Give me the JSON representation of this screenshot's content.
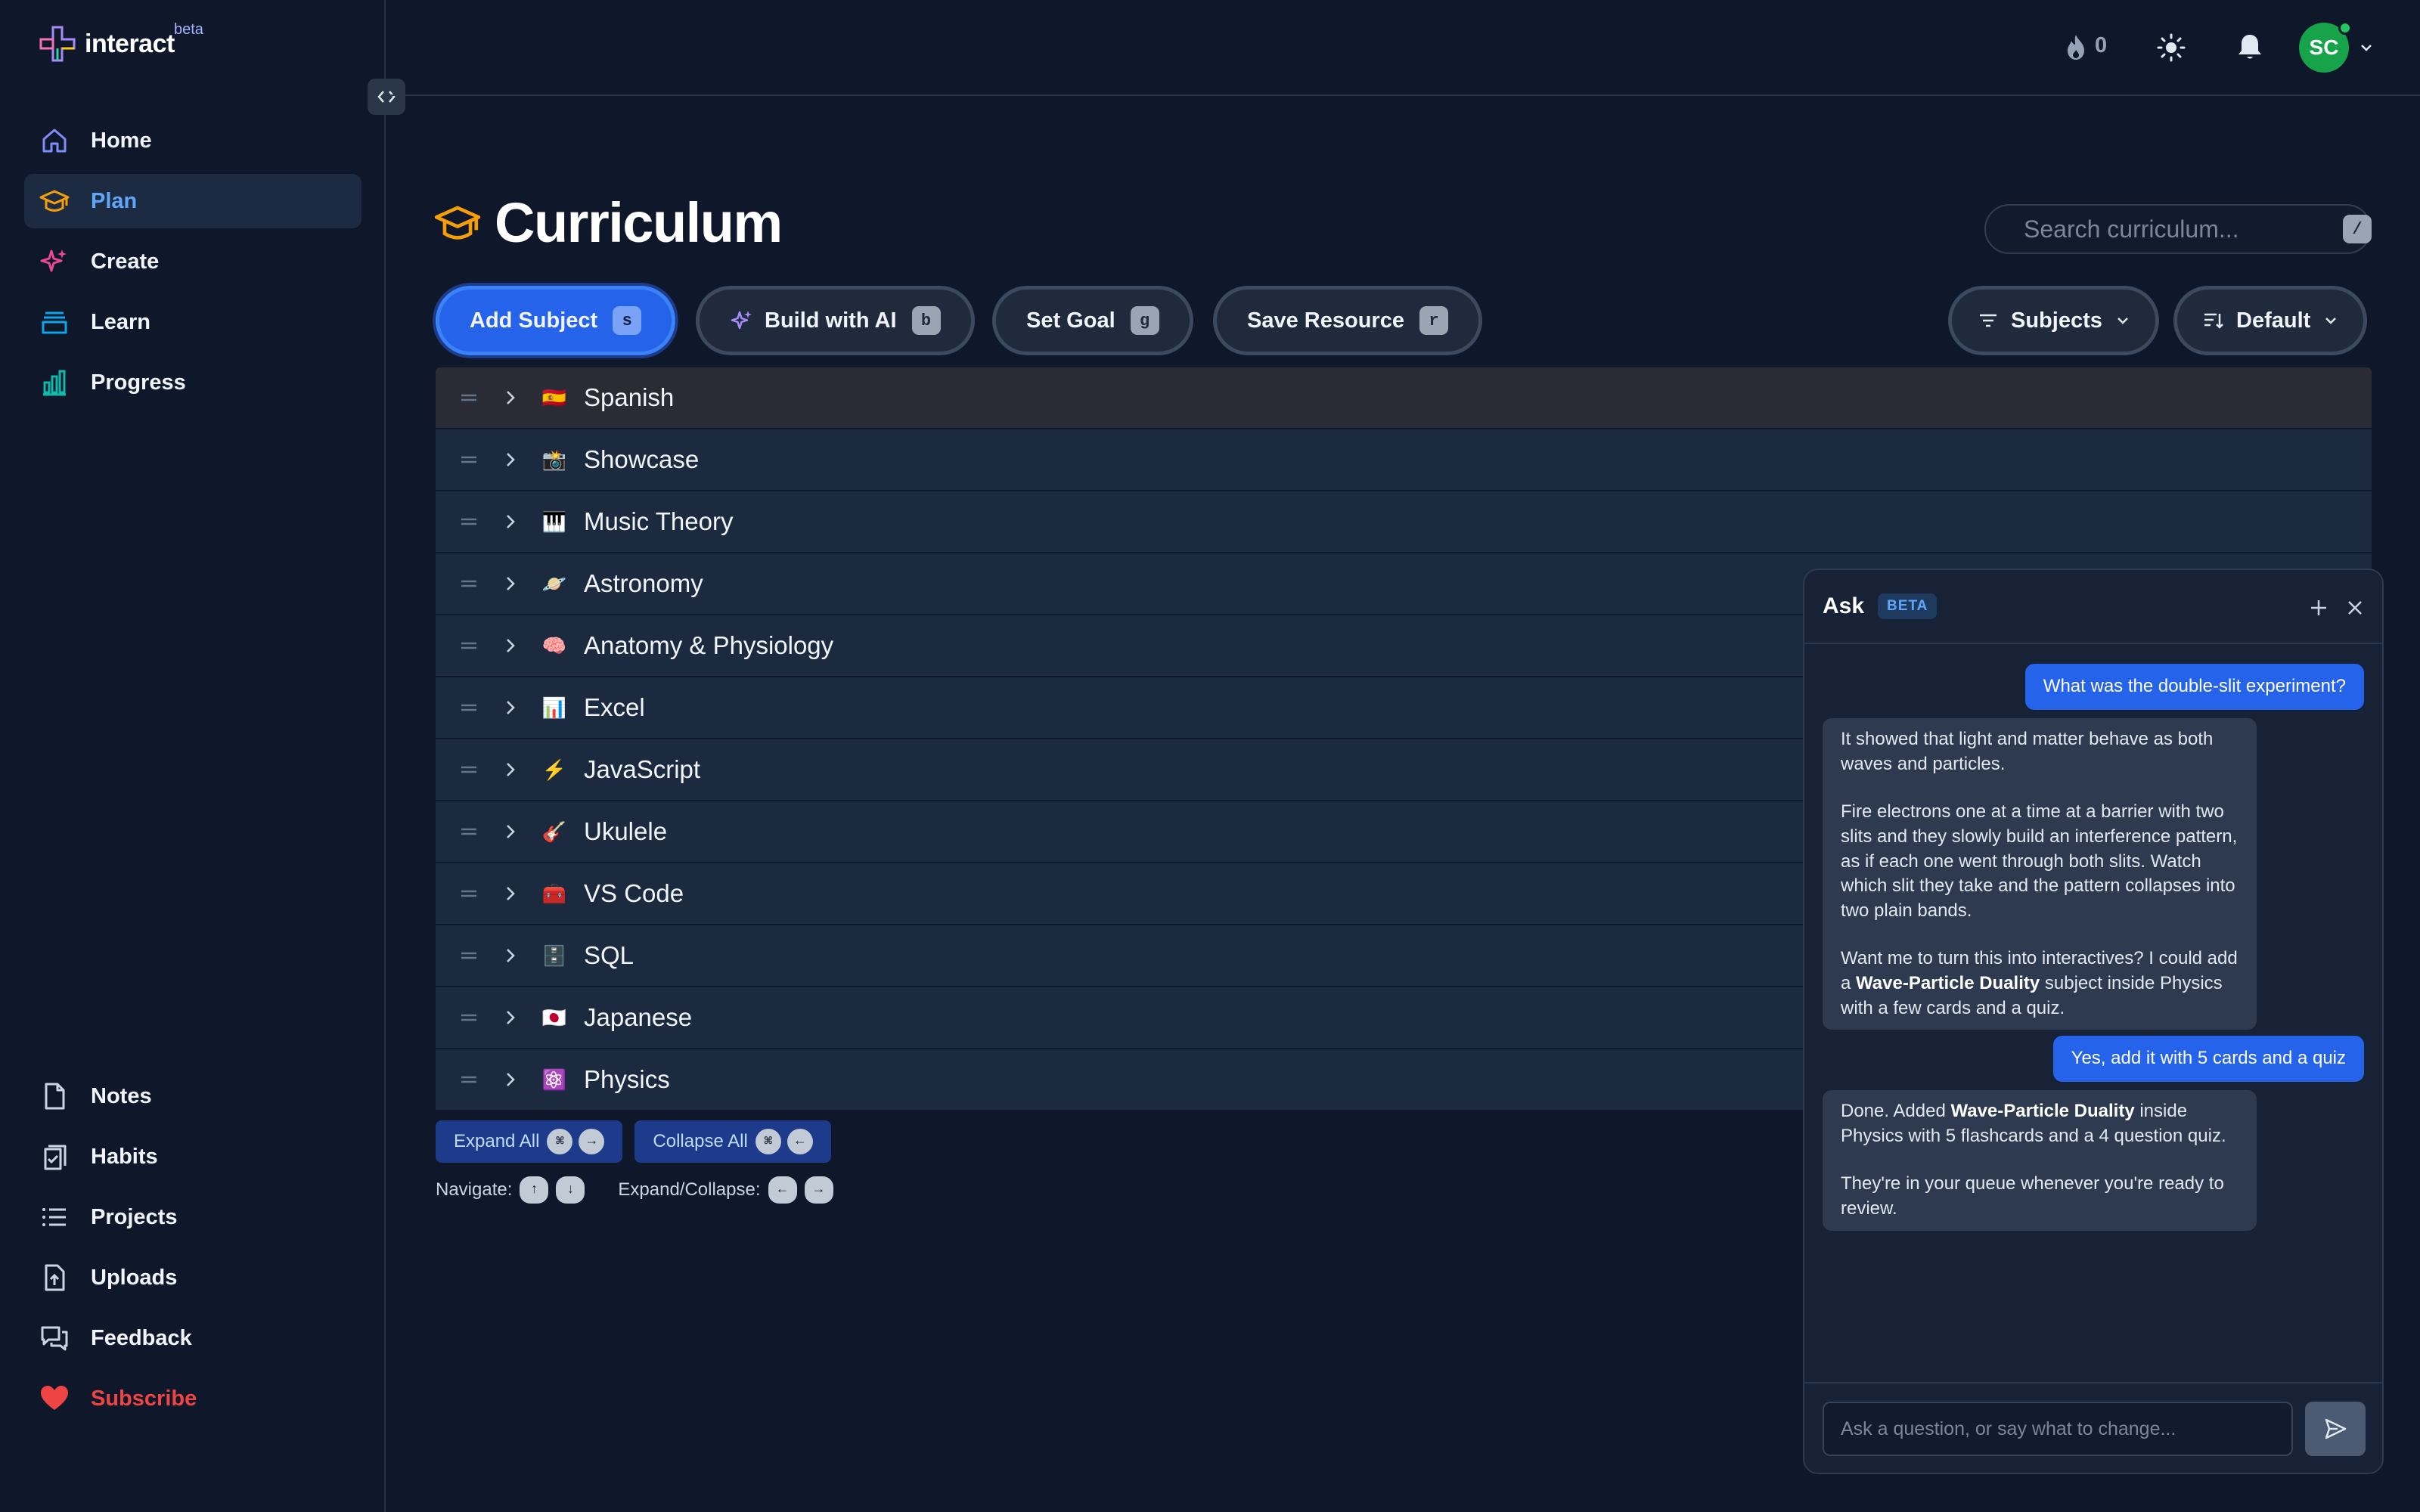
{
  "app": {
    "name": "interact",
    "badge": "beta"
  },
  "sidebar": {
    "main": [
      {
        "label": "Home",
        "icon": "home-icon"
      },
      {
        "label": "Plan",
        "icon": "graduation-cap-icon",
        "active": true
      },
      {
        "label": "Create",
        "icon": "sparkles-icon"
      },
      {
        "label": "Learn",
        "icon": "archive-box-icon"
      },
      {
        "label": "Progress",
        "icon": "bar-chart-icon"
      }
    ],
    "secondary": [
      {
        "label": "Notes",
        "icon": "file-icon"
      },
      {
        "label": "Habits",
        "icon": "checklist-icon"
      },
      {
        "label": "Projects",
        "icon": "list-icon"
      },
      {
        "label": "Uploads",
        "icon": "upload-icon"
      },
      {
        "label": "Feedback",
        "icon": "chat-bubbles-icon"
      },
      {
        "label": "Subscribe",
        "icon": "heart-icon"
      }
    ]
  },
  "header": {
    "streak_count": "0",
    "avatar_initials": "SC"
  },
  "page": {
    "title": "Curriculum"
  },
  "search": {
    "placeholder": "Search curriculum...",
    "shortcut": "/"
  },
  "actions": [
    {
      "label": "Add Subject",
      "shortcut": "s"
    },
    {
      "label": "Build with AI",
      "shortcut": "b"
    },
    {
      "label": "Set Goal",
      "shortcut": "g"
    },
    {
      "label": "Save Resource",
      "shortcut": "r"
    }
  ],
  "filters": {
    "subjects_label": "Subjects",
    "sort_label": "Default"
  },
  "subjects": [
    {
      "name": "Spanish",
      "emoji": "🇪🇸"
    },
    {
      "name": "Showcase",
      "emoji": "📸"
    },
    {
      "name": "Music Theory",
      "emoji": "🎹"
    },
    {
      "name": "Astronomy",
      "emoji": "🪐"
    },
    {
      "name": "Anatomy & Physiology",
      "emoji": "🧠"
    },
    {
      "name": "Excel",
      "emoji": "📊"
    },
    {
      "name": "JavaScript",
      "emoji": "⚡"
    },
    {
      "name": "Ukulele",
      "emoji": "🎸"
    },
    {
      "name": "VS Code",
      "emoji": "🧰"
    },
    {
      "name": "SQL",
      "emoji": "🗄️"
    },
    {
      "name": "Japanese",
      "emoji": "🇯🇵"
    },
    {
      "name": "Physics",
      "emoji": "⚛️"
    }
  ],
  "list_controls": {
    "expand_label": "Expand All",
    "collapse_label": "Collapse All",
    "cmd_key": "⌘",
    "right_arrow": "→",
    "left_arrow": "←",
    "up_arrow": "↑",
    "down_arrow": "↓",
    "navigate_label": "Navigate:",
    "expand_collapse_label": "Expand/Collapse:"
  },
  "ask": {
    "title": "Ask",
    "badge": "BETA",
    "input_placeholder": "Ask a question, or say what to change...",
    "msg1": "What was the double-slit experiment?",
    "msg2_p1": "It showed that light and matter behave as both waves and particles.",
    "msg2_p2": "Fire electrons one at a time at a barrier with two slits and they slowly build an interference pattern, as if each one went through both slits. Watch which slit they take and the pattern collapses into two plain bands.",
    "msg2_p3_pre": "Want me to turn this into interactives? I could add a",
    "msg2_p3_bold": "Wave-Particle Duality",
    "msg2_p3_post": "subject inside Physics with a few cards and a quiz.",
    "msg3": "Yes, add it with 5 cards and a quiz",
    "msg4_p1_pre": "Done. Added",
    "msg4_p1_bold": "Wave-Particle Duality",
    "msg4_p1_post": "inside Physics with 5 flashcards and a 4 question quiz.",
    "msg4_p2": "They're in your queue whenever you're ready to review."
  },
  "colors": {
    "background": "#0f172b",
    "accent": "#2563eb",
    "active_nav": "#60a5fa",
    "subscribe": "#ef4444",
    "avatar": "#16a34a"
  }
}
